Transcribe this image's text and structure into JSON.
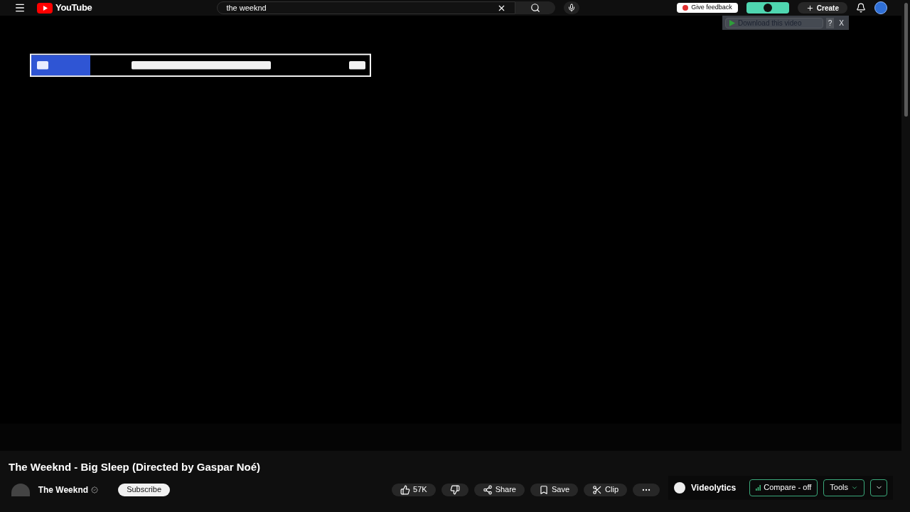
{
  "header": {
    "logo_text": "YouTube",
    "search_value": "the weeknd",
    "feedback_button": "Give feedback",
    "create_button": "Create"
  },
  "download_bar": {
    "button": "Download this video",
    "help": "?",
    "close": "X"
  },
  "title": "The Weeknd - Big Sleep (Directed by Gaspar Noé)",
  "channel": {
    "name": "The Weeknd",
    "verified": true
  },
  "subscribe_button": "Subscribe",
  "actions": [
    {
      "kind": "like",
      "label": "57K"
    },
    {
      "kind": "dislike"
    },
    {
      "kind": "share",
      "label": "Share"
    },
    {
      "kind": "save",
      "label": "Save"
    },
    {
      "kind": "clip",
      "label": "Clip"
    },
    {
      "kind": "more"
    }
  ],
  "videolytics": {
    "name": "Videolytics",
    "compare": "Compare - off",
    "tools": "Tools"
  }
}
